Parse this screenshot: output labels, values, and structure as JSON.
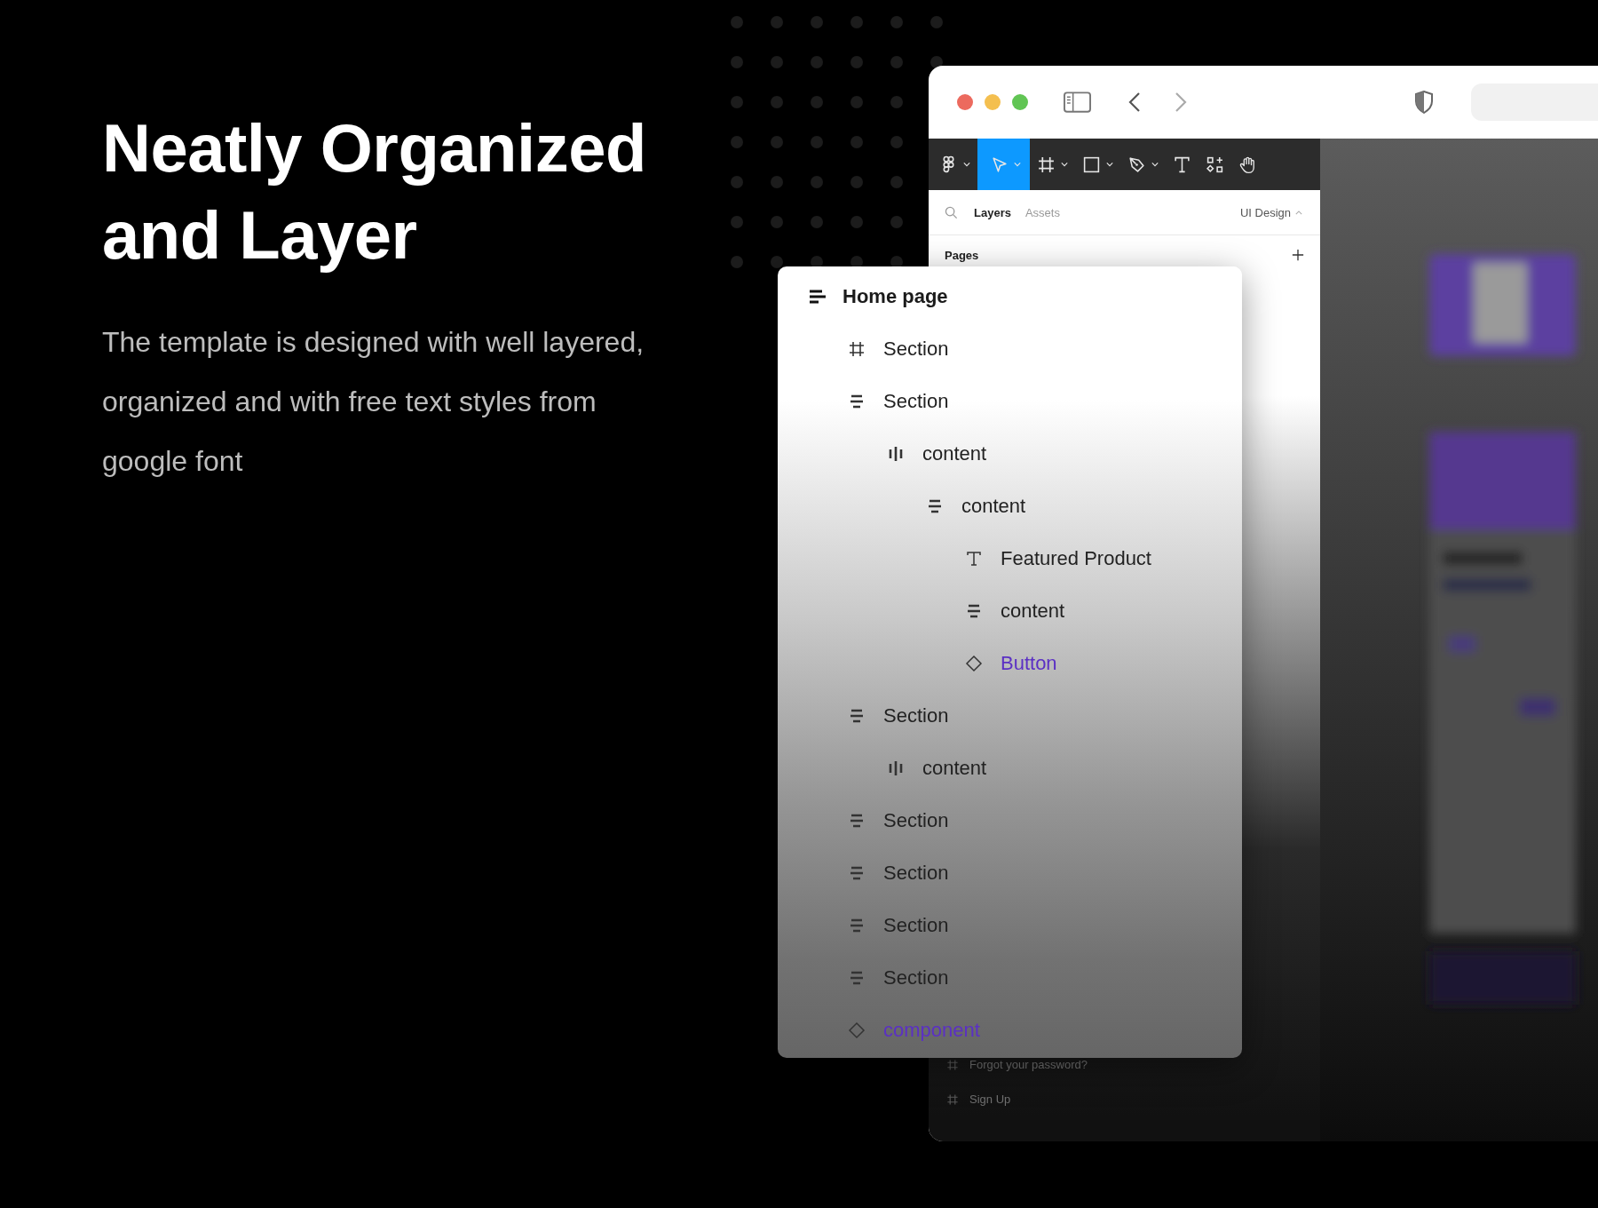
{
  "headline": "Neatly Organized and Layer",
  "description": "The template is designed with well layered, organized and with free text styles from google font",
  "window": {
    "traffic_lights": [
      {
        "color": "#ec6a5e"
      },
      {
        "color": "#f4bf4f"
      },
      {
        "color": "#61c554"
      }
    ]
  },
  "toolbar": [
    {
      "kind": "logo",
      "selected": false,
      "has_menu": true
    },
    {
      "kind": "move",
      "selected": true,
      "has_menu": true
    },
    {
      "kind": "frame",
      "selected": false,
      "has_menu": true
    },
    {
      "kind": "shape",
      "selected": false,
      "has_menu": true
    },
    {
      "kind": "pen",
      "selected": false,
      "has_menu": true
    },
    {
      "kind": "text",
      "selected": false,
      "has_menu": false
    },
    {
      "kind": "resources",
      "selected": false,
      "has_menu": false
    },
    {
      "kind": "hand",
      "selected": false,
      "has_menu": false
    }
  ],
  "panel_tabs": [
    {
      "label": "Layers",
      "selected": true
    },
    {
      "label": "Assets",
      "selected": false
    }
  ],
  "page_selector": "UI Design",
  "pages_label": "Pages",
  "layers": {
    "title": "Home page",
    "children": [
      {
        "name": "Section",
        "kind": "frame"
      },
      {
        "name": "Section",
        "kind": "stack",
        "children": [
          {
            "name": "content",
            "kind": "columns",
            "children": [
              {
                "name": "content",
                "kind": "stack",
                "children": [
                  {
                    "name": "Featured Product",
                    "kind": "text"
                  },
                  {
                    "name": "content",
                    "kind": "stack"
                  },
                  {
                    "name": "Button",
                    "kind": "component"
                  }
                ]
              }
            ]
          }
        ]
      },
      {
        "name": "Section",
        "kind": "stack",
        "children": [
          {
            "name": "content",
            "kind": "columns"
          }
        ]
      },
      {
        "name": "Section",
        "kind": "stack"
      },
      {
        "name": "Section",
        "kind": "stack"
      },
      {
        "name": "Section",
        "kind": "stack"
      },
      {
        "name": "Section",
        "kind": "stack"
      },
      {
        "name": "component",
        "kind": "component"
      }
    ]
  },
  "lower_layers": [
    {
      "name": "Forgot your password?",
      "kind": "frame"
    },
    {
      "name": "Sign Up",
      "kind": "frame"
    }
  ]
}
